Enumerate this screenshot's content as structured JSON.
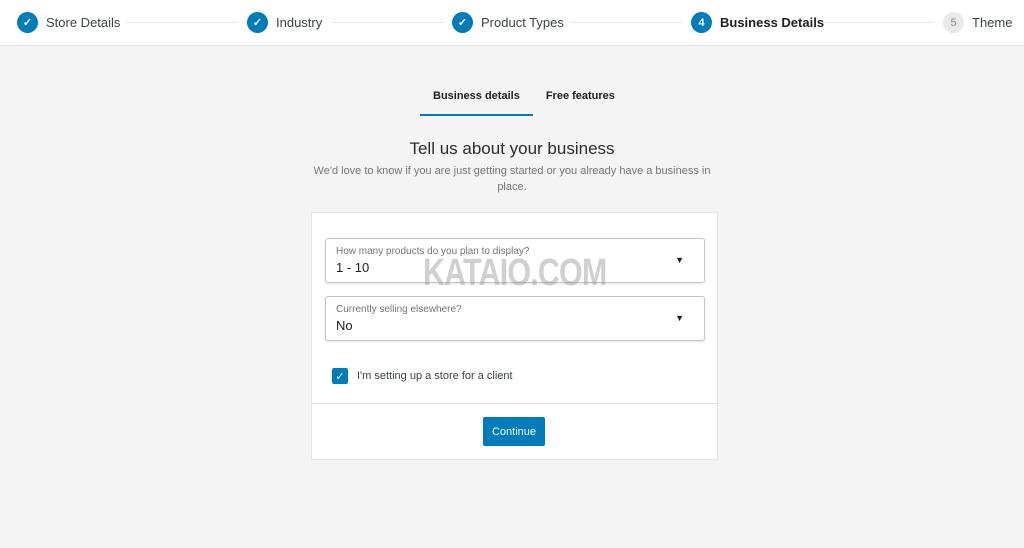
{
  "stepper": {
    "steps": [
      {
        "label": "Store Details",
        "status": "complete",
        "marker": "check-icon"
      },
      {
        "label": "Industry",
        "status": "complete",
        "marker": "check-icon"
      },
      {
        "label": "Product Types",
        "status": "complete",
        "marker": "check-icon"
      },
      {
        "label": "Business Details",
        "status": "active",
        "number": "4"
      },
      {
        "label": "Theme",
        "status": "upcoming",
        "number": "5"
      }
    ]
  },
  "tabs": [
    {
      "label": "Business details",
      "active": true
    },
    {
      "label": "Free features",
      "active": false
    }
  ],
  "main": {
    "title": "Tell us about your business",
    "subtitle": "We'd love to know if you are just getting started or you already have a business in place."
  },
  "form": {
    "products": {
      "label": "How many products do you plan to display?",
      "value": "1 - 10"
    },
    "selling": {
      "label": "Currently selling elsewhere?",
      "value": "No"
    },
    "client_checkbox": {
      "label": "I'm setting up a store for a client",
      "checked": true
    },
    "continue_label": "Continue"
  },
  "watermark": "KATAIO.COM",
  "colors": {
    "accent": "#007cba",
    "background": "#f3f4f3"
  }
}
